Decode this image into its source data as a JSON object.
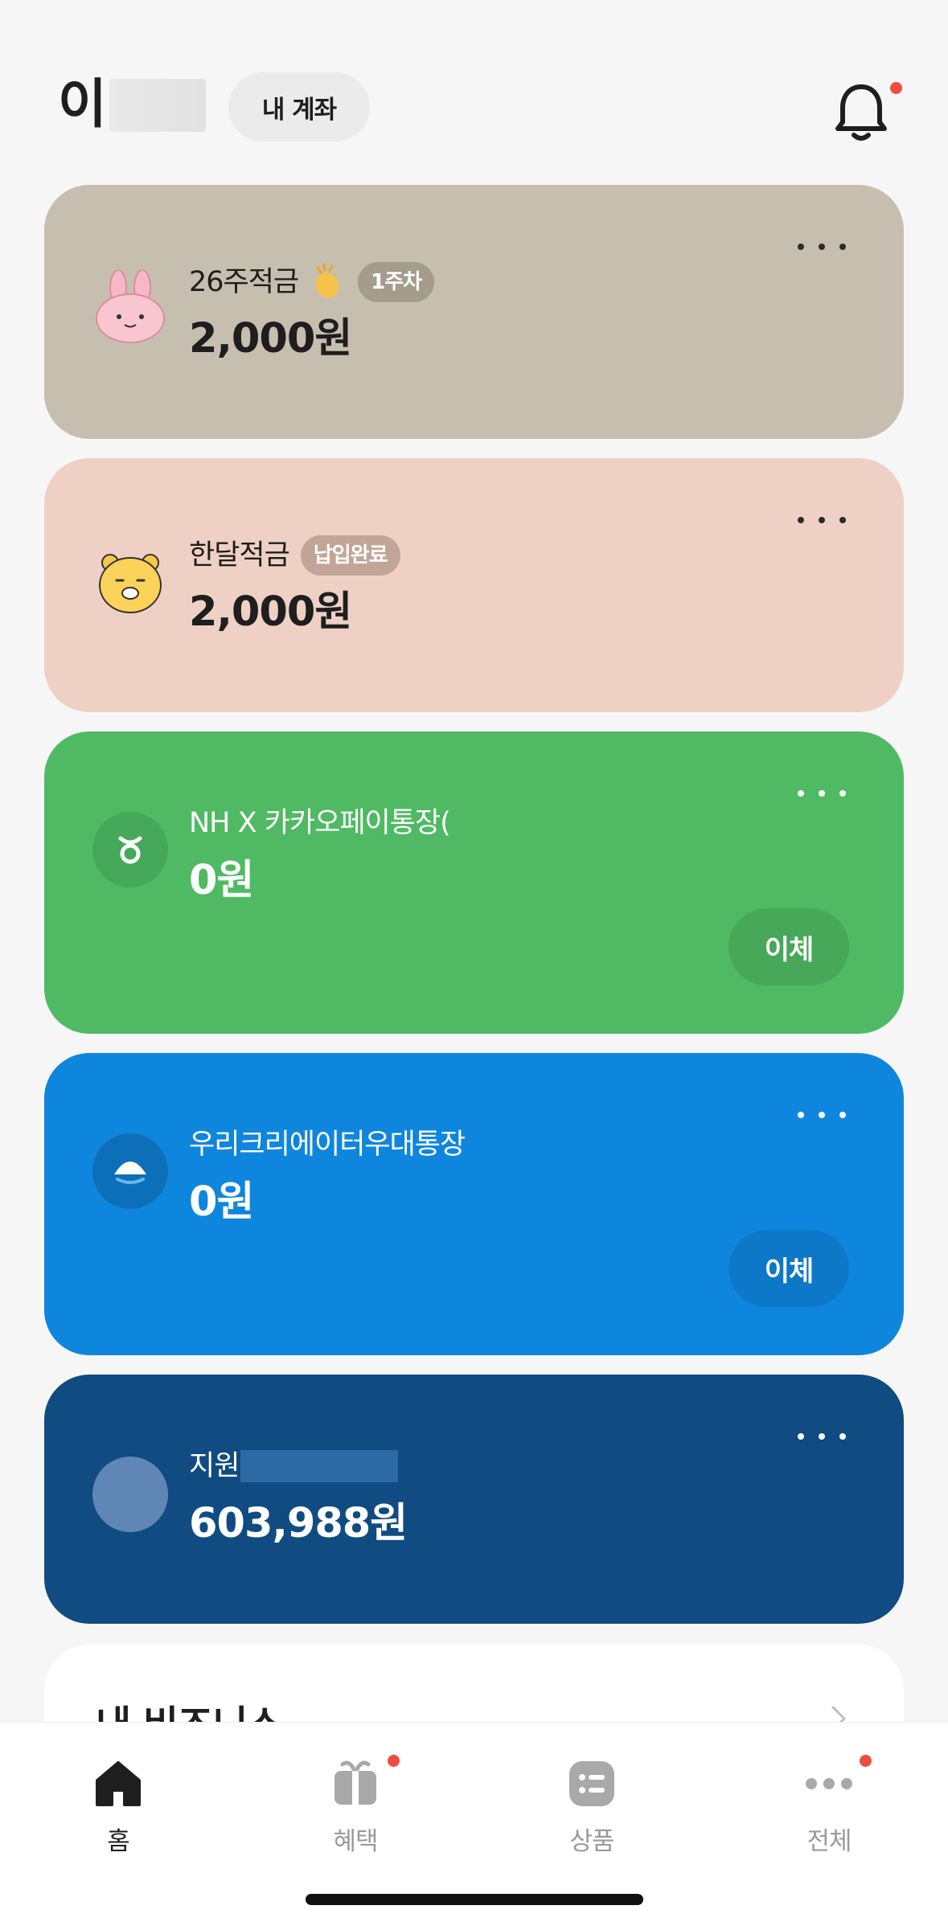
{
  "header": {
    "user_name": "이",
    "my_accounts_label": "내 계좌",
    "icons": {
      "notification": "bell-icon"
    }
  },
  "accounts": [
    {
      "title": "26주적금",
      "badge": "1주차",
      "amount": "2,000원",
      "icon": "rabbit-character-icon",
      "bg": "#c6bfaf",
      "badge_bg": "#a59c8c"
    },
    {
      "title": "한달적금",
      "badge": "납입완료",
      "amount": "2,000원",
      "icon": "lion-character-icon",
      "bg": "#eed1c4",
      "badge_bg": "#c3a597"
    },
    {
      "title": "NH X 카카오페이통장(",
      "amount": "0원",
      "transfer_label": "이체",
      "icon": "nh-bank-icon",
      "bg": "#4fba63",
      "btn_bg": "#47a85a"
    },
    {
      "title": "우리크리에이터우대통장",
      "amount": "0원",
      "transfer_label": "이체",
      "icon": "woori-bank-icon",
      "bg": "#0f86de",
      "btn_bg": "#0d78c8"
    },
    {
      "title": "지원",
      "amount": "603,988원",
      "icon": "bank-logo-icon",
      "bg": "#104b82"
    }
  ],
  "business": {
    "title": "내 비즈니스"
  },
  "nav": [
    {
      "label": "홈",
      "icon": "home-icon",
      "active": true,
      "dot": false
    },
    {
      "label": "혜택",
      "icon": "gift-icon",
      "active": false,
      "dot": true
    },
    {
      "label": "상품",
      "icon": "list-icon",
      "active": false,
      "dot": false
    },
    {
      "label": "전체",
      "icon": "more-horizontal-icon",
      "active": false,
      "dot": true
    }
  ],
  "colors": {
    "background": "#f6f6f7",
    "notification_dot": "#f04d42"
  }
}
